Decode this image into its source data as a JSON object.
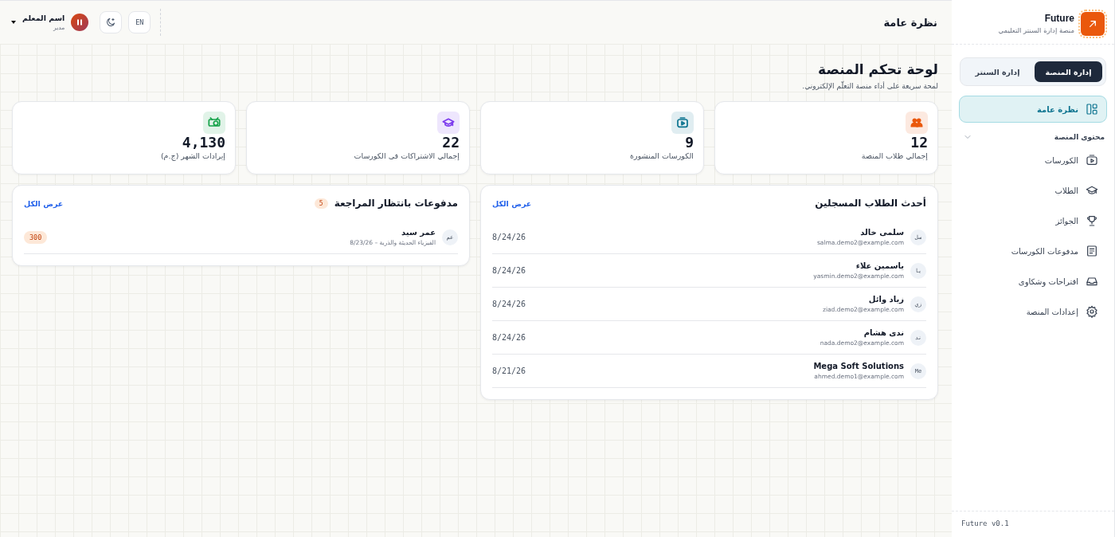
{
  "sidebar": {
    "brand": {
      "name": "Future",
      "tagline": "منصة إدارة السنتر التعليمي"
    },
    "tabs": [
      {
        "label": "إدارة المنصة",
        "selected": true
      },
      {
        "label": "إدارة السنتر",
        "selected": false
      }
    ],
    "nav": [
      {
        "label": "نظرة عامة",
        "kind": "grid",
        "selected": true
      }
    ],
    "section": {
      "label": "محتوى المنصة",
      "expanded": true,
      "items": [
        {
          "label": "الكورسات",
          "kind": "video",
          "selected": false
        },
        {
          "label": "الطلاب",
          "kind": "cap",
          "selected": false
        },
        {
          "label": "الجوائز",
          "kind": "trophy",
          "selected": false
        },
        {
          "label": "مدفوعات الكورسات",
          "kind": "doc",
          "selected": false
        },
        {
          "label": "اقتراحات وشكاوى",
          "kind": "inbox",
          "selected": false
        },
        {
          "label": "إعدادات المنصة",
          "kind": "gear",
          "selected": false
        }
      ]
    },
    "version": "Future v0.1"
  },
  "header": {
    "title": "نظرة عامة",
    "language": "EN",
    "user": {
      "name": "اسم المعلم",
      "role": "مدير"
    }
  },
  "dashboard": {
    "title": "لوحة تحكم المنصة",
    "subtitle": "لمحة سريعة على أداء منصة التعلّم الإلكتروني."
  },
  "stats": [
    {
      "value": "12",
      "label": "إجمالي طلاب المنصة",
      "kind": "users",
      "color": "#ea580c"
    },
    {
      "value": "9",
      "label": "الكورسات المنشورة",
      "kind": "video",
      "color": "#0e7490"
    },
    {
      "value": "22",
      "label": "إجمالي الاشتراكات فى الكورسات",
      "kind": "cap",
      "color": "#7c3aed"
    },
    {
      "value": "4,130",
      "label": "إيرادات الشهر (ج.م)",
      "kind": "cash",
      "color": "#16a34a"
    }
  ],
  "recent_students": {
    "title": "أحدث الطلاب المسجلين",
    "link": "عرض الكل",
    "rows": [
      {
        "initials": "سل",
        "name": "سلمى خالد",
        "email": "salma.demo2@example.com",
        "date": "8/24/26"
      },
      {
        "initials": "يا",
        "name": "ياسمين علاء",
        "email": "yasmin.demo2@example.com",
        "date": "8/24/26"
      },
      {
        "initials": "زي",
        "name": "زياد وائل",
        "email": "ziad.demo2@example.com",
        "date": "8/24/26"
      },
      {
        "initials": "ند",
        "name": "ندى هشام",
        "email": "nada.demo2@example.com",
        "date": "8/24/26"
      },
      {
        "initials": "Me",
        "name": "Mega Soft Solutions",
        "email": "ahmed.demo1@example.com",
        "date": "8/21/26"
      }
    ]
  },
  "pending_payments": {
    "title": "مدفوعات بانتظار المراجعة",
    "count": "5",
    "link": "عرض الكل",
    "rows": [
      {
        "initials": "عم",
        "name": "عمر سيد",
        "detail": "الفيزياء الحديثة والذرية – 8/23/26",
        "amount": "300"
      }
    ]
  }
}
